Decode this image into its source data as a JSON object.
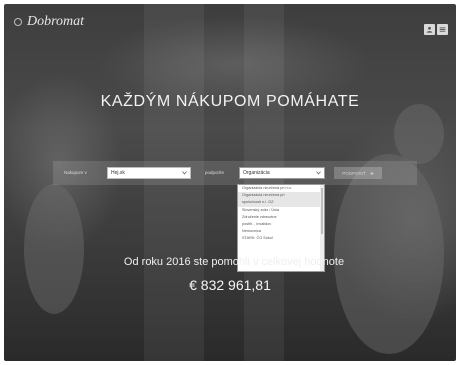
{
  "brand": {
    "name": "Dobromat",
    "logo_icon": "circle-logo-icon"
  },
  "top_right": {
    "icons": [
      "user-icon",
      "menu-icon"
    ]
  },
  "hero": {
    "headline": "KAŽDÝM NÁKUPOM POMÁHATE",
    "since_text": "Od roku 2016 ste pomohli v celkovej hodnote",
    "amount": "€ 832 961,81"
  },
  "search": {
    "shop_label": "Nakupom v",
    "shop_value": "Hej.sk",
    "org_label": "podporíte",
    "org_value": "Organizácia",
    "submit_label": "PODPORIŤ",
    "submit_icon": "arrow-right-icon"
  },
  "dropdown": {
    "options": [
      "Organizácia neurčená pri n.o.",
      "Organizácia neurčená pri",
      "spoločnosti n.i. OZ",
      "Slovenský zväz / Únia",
      "Združenie zdravotne",
      "postih. , invalidov",
      "Nemocnica",
      "STARK: ČO Sokol"
    ],
    "selected_index": 1
  },
  "colors": {
    "accent": "#ffffff",
    "background": "#3e3e3e"
  }
}
